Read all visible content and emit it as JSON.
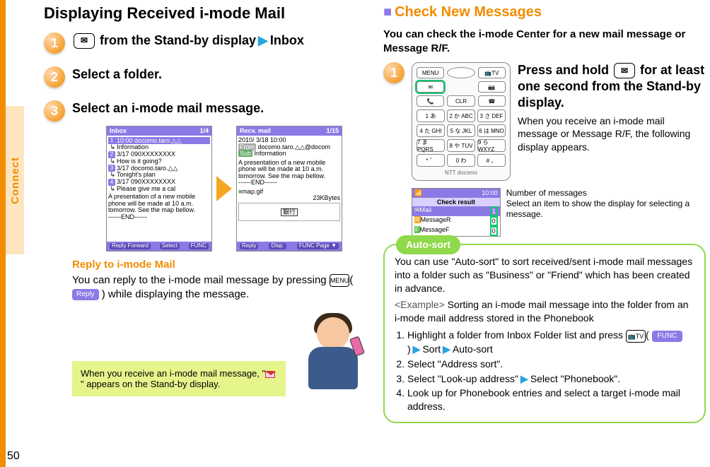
{
  "page_number": "50",
  "side_tab": "Connect",
  "left": {
    "title": "Displaying Received i-mode Mail",
    "steps": {
      "s1_a": " from the Stand-by display",
      "s1_b": "Inbox",
      "s2": "Select a folder.",
      "s3": "Select an i-mode mail message."
    },
    "key_mail": "✉",
    "scr1": {
      "bar_title": "Inbox",
      "bar_page": "1/4",
      "rows": [
        "10:00 docomo.taro.△△",
        "Information",
        "3/17 090XXXXXXXX",
        "How is it going?",
        "3/17 docomo.taro.△△",
        "Tonight's plan",
        "3/17 090XXXXXXXX",
        "Please give me a cal"
      ],
      "preview": "A presentation of a new mobile phone will be made at 10 a.m. tomorrow. See the map bellow.\n------END------",
      "foot_l": "Reply Forward",
      "foot_c": "Select",
      "foot_r": "FUNC"
    },
    "scr2": {
      "bar_title": "Recv. mail",
      "bar_page": "1/15",
      "date": "2010/ 3/18 10:00",
      "from_label": "From",
      "from": "docomo.taro.△△@docom",
      "sub_label": "Sub",
      "sub": "Information",
      "body": "A presentation of a new mobile phone will be made at 10 a.m. tomorrow. See the map bellow.\n------END------",
      "attach": "map.gif",
      "size": "23KBytes",
      "map_label": "銀行",
      "foot_l": "Reply",
      "foot_c": "Disp.",
      "foot_r": "FUNC Page ▼"
    },
    "reply_h": "Reply to i-mode Mail",
    "reply_p1": "You can reply to the i-mode mail message by pressing ",
    "reply_menu": "MENU",
    "reply_soft": "Reply",
    "reply_p2": " while displaying the message.",
    "balloon_a": "When you receive an i-mode mail message, \"",
    "balloon_b": "\" appears on the Stand-by display."
  },
  "right": {
    "sec_title": "Check New Messages",
    "intro": "You can check the i-mode Center for a new mail message or Message R/F.",
    "step1_h": "Press and hold ",
    "step1_h2": " for at least one second from the Stand-by display.",
    "step1_key": "✉",
    "step1_p": "When you receive an i-mode mail message or Message R/F, the following display appears.",
    "keypad": {
      "top": [
        "MENU",
        "",
        "📺TV",
        "✉",
        "",
        "📷",
        "📞",
        "CLR",
        "☎"
      ],
      "keys": [
        "1 あ",
        "2 か ABC",
        "3 さ DEF",
        "4 た GHI",
        "5 な JKL",
        "6 は MNO",
        "7 ま PQRS",
        "8 や TUV",
        "9 ら WXYZ",
        "* ゛",
        "0 わ",
        "# 、"
      ],
      "brand": "NTT docomo"
    },
    "check_scr": {
      "top_l": "📶",
      "top_r": "10:00",
      "title": "Check result",
      "rows": [
        {
          "l": "Mail",
          "r": "1"
        },
        {
          "l": "MessageR",
          "r": "0",
          "pre": "R"
        },
        {
          "l": "MessageF",
          "r": "0",
          "pre": "F"
        }
      ]
    },
    "cap_a": "Number of messages",
    "cap_b": "Select an item to show the display for selecting a message.",
    "autosort": {
      "tag": "Auto-sort",
      "p1": "You can use \"Auto-sort\" to sort received/sent i-mode mail messages into a folder such as \"Business\" or \"Friend\" which has been created in advance.",
      "ex_label": "<Example>",
      "ex": "Sorting an i-mode mail message into the folder from an i-mode mail address stored in the Phonebook",
      "li1a": "Highlight a folder from Inbox Folder list and press ",
      "li1_key": "📺TV",
      "li1_soft": "FUNC",
      "li1b": "Sort",
      "li1c": "Auto-sort",
      "li2": "Select \"Address sort\".",
      "li3a": "Select \"Look-up address\"",
      "li3b": "Select \"Phonebook\".",
      "li4": "Look up for Phonebook entries and select a target i-mode mail address."
    }
  }
}
